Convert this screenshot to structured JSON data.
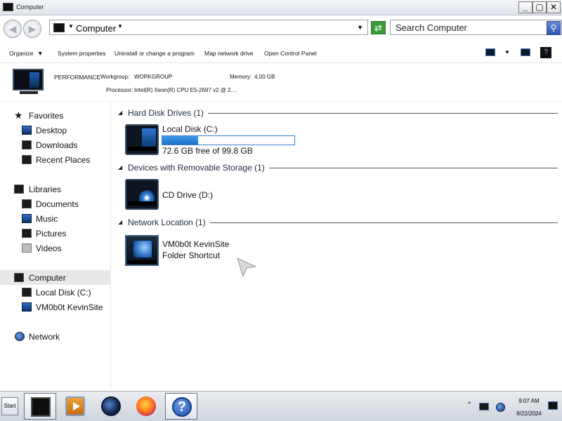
{
  "window": {
    "title": "Computer",
    "minimize": "_",
    "maximize": "▢",
    "close": "✕"
  },
  "address": {
    "breadcrumb": "Computer",
    "search_placeholder": "Search Computer"
  },
  "toolbar": {
    "organize": "Organize",
    "system_properties": "System properties",
    "uninstall": "Uninstall or change a program",
    "map_drive": "Map network drive",
    "control_panel": "Open Control Panel"
  },
  "details": {
    "computer_name": "PERFORMANCE",
    "workgroup_label": "Workgroup:",
    "workgroup_value": "WORKGROUP",
    "memory_label": "Memory:",
    "memory_value": "4.00 GB",
    "processor_label": "Processor:",
    "processor_value": "Intel(R) Xeon(R) CPU E5-2697 v2 @ 2...."
  },
  "nav": {
    "favorites": "Favorites",
    "desktop": "Desktop",
    "downloads": "Downloads",
    "recent": "Recent Places",
    "libraries": "Libraries",
    "documents": "Documents",
    "music": "Music",
    "pictures": "Pictures",
    "videos": "Videos",
    "computer": "Computer",
    "local_disk": "Local Disk (C:)",
    "vm_site": "VM0b0t KevinSite",
    "network": "Network"
  },
  "groups": {
    "hdd": {
      "title": "Hard Disk Drives (1)",
      "name": "Local Disk (C:)",
      "free_text": "72.6 GB free of 99.8 GB",
      "used_fraction": 0.273
    },
    "removable": {
      "title": "Devices with Removable Storage (1)",
      "name": "CD Drive (D:)"
    },
    "network": {
      "title": "Network Location (1)",
      "name": "VM0b0t KevinSite",
      "sub": "Folder Shortcut"
    }
  },
  "taskbar": {
    "start": "Start",
    "time": "9:07 AM",
    "date": "8/22/2024"
  }
}
